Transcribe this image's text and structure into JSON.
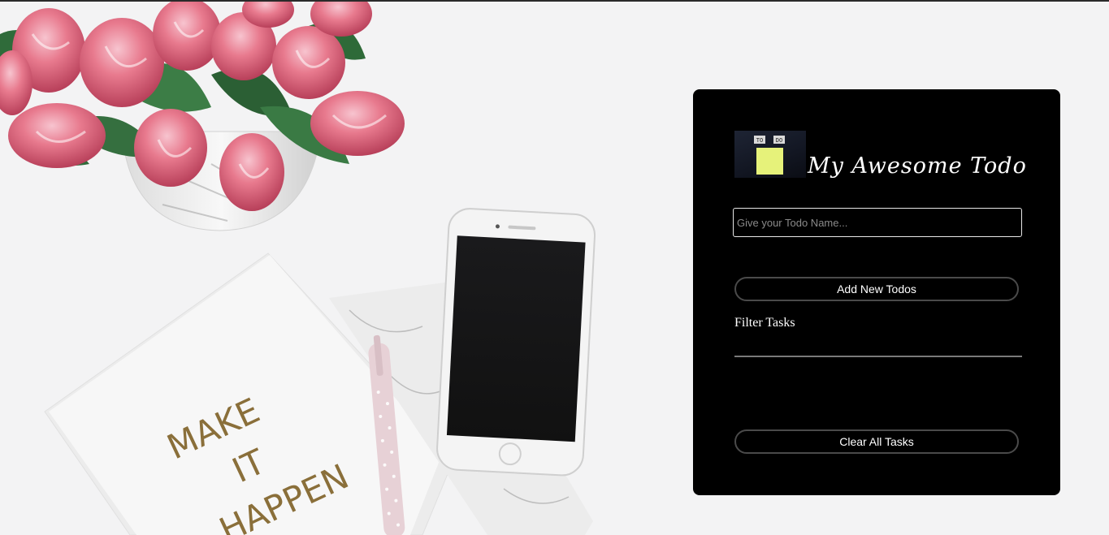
{
  "app": {
    "title": "My Awesome Todo",
    "logo_letters": [
      "T",
      "O",
      "D",
      "O"
    ],
    "input_placeholder": "Give your Todo Name...",
    "input_value": "",
    "add_button_label": "Add New Todos",
    "filter_label": "Filter Tasks",
    "filter_value": "",
    "clear_button_label": "Clear All Tasks"
  },
  "background": {
    "notebook_text": [
      "MAKE",
      "IT",
      "HAPPEN"
    ]
  },
  "colors": {
    "card_bg": "#000000",
    "accent_sticky_note": "#e6f27a",
    "tulip_pink": "#e26a80"
  }
}
